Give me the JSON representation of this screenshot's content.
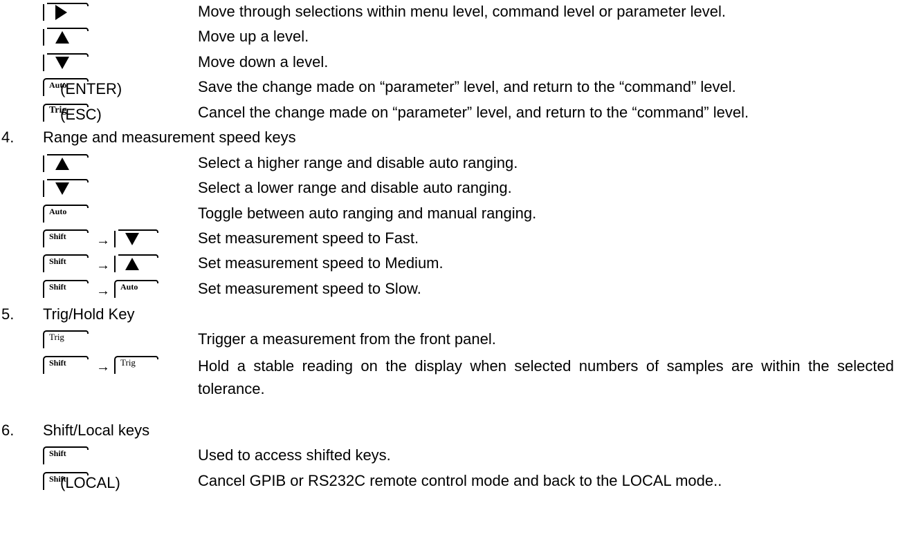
{
  "nav_keys": [
    {
      "desc": "Move through selections within menu level, command level or parameter level."
    },
    {
      "desc": "Move up a level."
    },
    {
      "desc": "Move down a level."
    },
    {
      "key_text": "Auto",
      "suffix": "(ENTER)",
      "desc": "Save the change made on “parameter” level, and return to the “command” level."
    },
    {
      "key_text": "Trig",
      "suffix": "(ESC)",
      "desc": "Cancel the change made on “parameter” level, and return to the “command” level."
    }
  ],
  "sections": [
    {
      "number": "4.",
      "title": "Range and measurement speed keys",
      "items": [
        {
          "desc": "Select a higher range and disable auto ranging."
        },
        {
          "desc": "Select a lower range and disable auto ranging."
        },
        {
          "key_text": "Auto",
          "desc": "Toggle between auto ranging and manual ranging."
        },
        {
          "key_text": "Shift",
          "arrow": "→",
          "desc": "Set measurement speed to Fast."
        },
        {
          "key_text": "Shift",
          "arrow": "→",
          "desc": "Set measurement speed to Medium."
        },
        {
          "key_text": "Shift",
          "arrow": "→",
          "key2_text": "Auto",
          "desc": "Set measurement speed to Slow."
        }
      ]
    },
    {
      "number": "5.",
      "title": "Trig/Hold Key",
      "items": [
        {
          "key_text": "Trig",
          "desc": "Trigger a measurement from the front panel."
        },
        {
          "key_text": "Shift",
          "arrow": "→",
          "key2_text": "Trig",
          "desc": "Hold a stable reading on the display when selected numbers of samples are within the selected tolerance."
        }
      ]
    },
    {
      "number": "6.",
      "title": "Shift/Local keys",
      "items": [
        {
          "key_text": "Shift",
          "desc": "Used to access shifted keys."
        },
        {
          "key_text": "Shift",
          "suffix": "(LOCAL)",
          "desc": "Cancel GPIB or RS232C remote control mode and back to the LOCAL mode.."
        }
      ]
    }
  ]
}
